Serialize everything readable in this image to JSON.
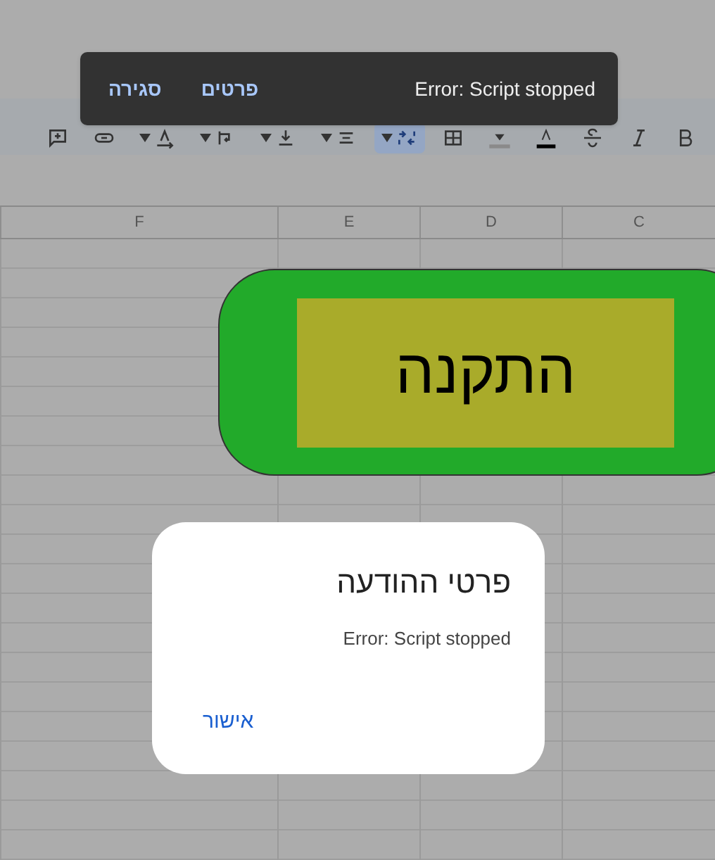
{
  "toast": {
    "message": "Error: Script stopped",
    "actions": [
      "פרטים",
      "סגירה"
    ]
  },
  "toolbar": [
    {
      "kind": "bold",
      "selected": false,
      "dropdown": false
    },
    {
      "kind": "italic",
      "selected": false,
      "dropdown": false
    },
    {
      "kind": "strikethrough",
      "selected": false,
      "dropdown": false
    },
    {
      "kind": "text-color",
      "selected": false,
      "dropdown": false
    },
    {
      "kind": "fill-color",
      "selected": false,
      "dropdown": false
    },
    {
      "kind": "borders",
      "selected": false,
      "dropdown": false
    },
    {
      "kind": "merge",
      "selected": true,
      "dropdown": true
    },
    {
      "kind": "align",
      "selected": false,
      "dropdown": true
    },
    {
      "kind": "valign",
      "selected": false,
      "dropdown": true
    },
    {
      "kind": "wrap",
      "selected": false,
      "dropdown": true
    },
    {
      "kind": "rotate",
      "selected": false,
      "dropdown": true
    },
    {
      "kind": "link",
      "selected": false,
      "dropdown": false
    },
    {
      "kind": "comment",
      "selected": false,
      "dropdown": false
    }
  ],
  "columns": [
    "C",
    "D",
    "E",
    "F"
  ],
  "shape": {
    "label": "התקנה"
  },
  "dialog": {
    "title": "פרטי ההודעה",
    "message": "Error: Script stopped",
    "button": "אישור"
  }
}
